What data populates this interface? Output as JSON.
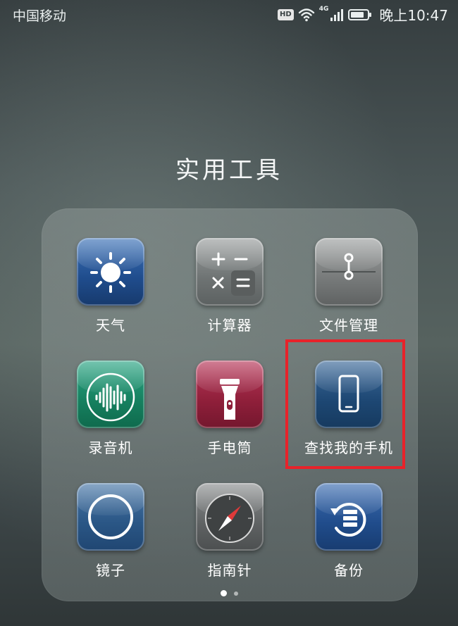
{
  "status_bar": {
    "carrier": "中国移动",
    "hd_label": "HD",
    "network_label": "4G",
    "time": "晚上10:47",
    "icons": [
      "hd-icon",
      "wifi-icon",
      "signal-icon",
      "battery-icon"
    ]
  },
  "folder": {
    "title": "实用工具",
    "apps": [
      {
        "label": "天气",
        "icon": "weather-sun-icon"
      },
      {
        "label": "计算器",
        "icon": "calculator-icon"
      },
      {
        "label": "文件管理",
        "icon": "file-manager-icon"
      },
      {
        "label": "录音机",
        "icon": "sound-recorder-icon"
      },
      {
        "label": "手电筒",
        "icon": "flashlight-icon"
      },
      {
        "label": "查找我的手机",
        "icon": "find-my-phone-icon"
      },
      {
        "label": "镜子",
        "icon": "mirror-icon"
      },
      {
        "label": "指南针",
        "icon": "compass-icon"
      },
      {
        "label": "备份",
        "icon": "backup-icon"
      }
    ],
    "highlighted_app": "查找我的手机",
    "highlight_color": "#e8222a"
  },
  "pagination": {
    "current_page": 1,
    "total_pages": 2
  }
}
